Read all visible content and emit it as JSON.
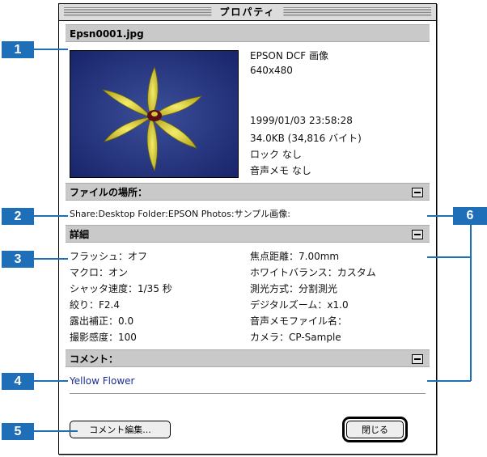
{
  "window": {
    "title": "プロパティ"
  },
  "file": {
    "name": "Epsn0001.jpg",
    "format": "EPSON DCF 画像",
    "dimensions": "640x480",
    "datetime": "1999/01/03  23:58:28",
    "size": "34.0KB (34,816 バイト)",
    "lock": "ロック なし",
    "voice_memo": "音声メモ なし"
  },
  "location": {
    "header": "ファイルの場所：",
    "path": "Share:Desktop Folder:EPSON Photos:サンプル画像:"
  },
  "details": {
    "header": "詳細",
    "left": [
      "フラッシュ：オフ",
      "マクロ：オン",
      "シャッタ速度：1/35 秒",
      "絞り：F2.4",
      "露出補正：0.0",
      "撮影感度：100"
    ],
    "right": [
      "焦点距離：7.00mm",
      "ホワイトバランス：カスタム",
      "測光方式：分割測光",
      "デジタルズーム：x1.0",
      "音声メモファイル名：",
      "カメラ：CP-Sample"
    ]
  },
  "comment": {
    "header": "コメント：",
    "text": "Yellow Flower"
  },
  "buttons": {
    "edit_comment": "コメント編集...",
    "close": "閉じる"
  },
  "callouts": [
    "1",
    "2",
    "3",
    "4",
    "5",
    "6"
  ],
  "colors": {
    "callout": "#1f6fb8",
    "section_bar": "#c9c9c9",
    "comment_text": "#1a2f8f"
  }
}
